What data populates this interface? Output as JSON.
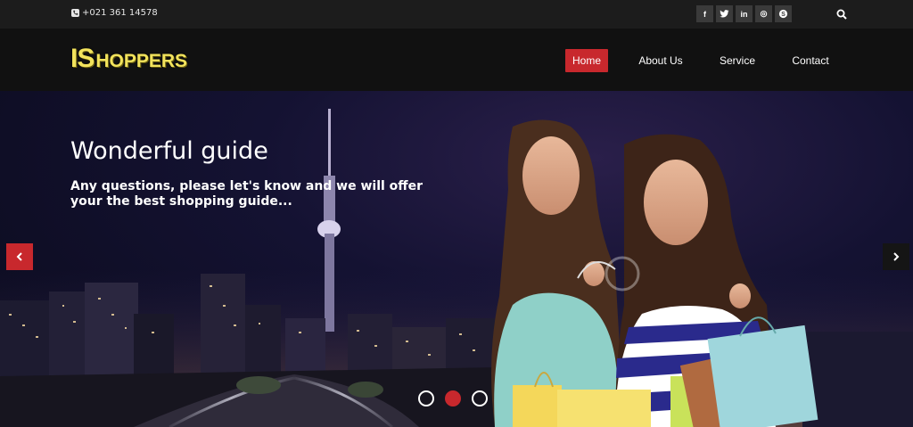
{
  "topbar": {
    "phone": "+021 361 14578",
    "socials": [
      {
        "name": "facebook",
        "glyph": "f"
      },
      {
        "name": "twitter",
        "glyph": "t"
      },
      {
        "name": "linkedin",
        "glyph": "in"
      },
      {
        "name": "dribbble",
        "glyph": "◎"
      },
      {
        "name": "skype",
        "glyph": "S"
      }
    ]
  },
  "logo": {
    "big": "IS",
    "small": "HOPPERS"
  },
  "nav": {
    "items": [
      {
        "label": "Home",
        "active": true
      },
      {
        "label": "About Us",
        "active": false
      },
      {
        "label": "Service",
        "active": false
      },
      {
        "label": "Contact",
        "active": false
      }
    ]
  },
  "hero": {
    "title": "Wonderful guide",
    "subtitle": "Any questions, please let's know and we will offer your the best shopping guide...",
    "slides": 3,
    "active_slide": 2
  },
  "colors": {
    "accent": "#c8282d",
    "logo": "#f2e35c",
    "topbar": "#1c1c1c",
    "nav": "#111111"
  }
}
